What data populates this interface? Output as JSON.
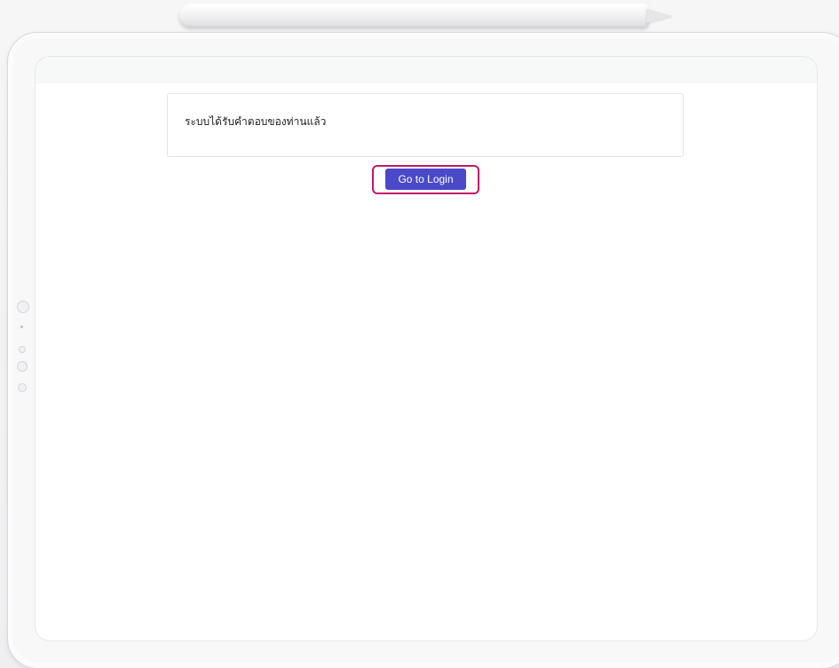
{
  "message": {
    "text": "ระบบได้รับคำตอบของท่านแล้ว"
  },
  "actions": {
    "login_label": "Go to Login"
  },
  "colors": {
    "button_bg": "#4949c9",
    "highlight_border": "#c2186b"
  }
}
